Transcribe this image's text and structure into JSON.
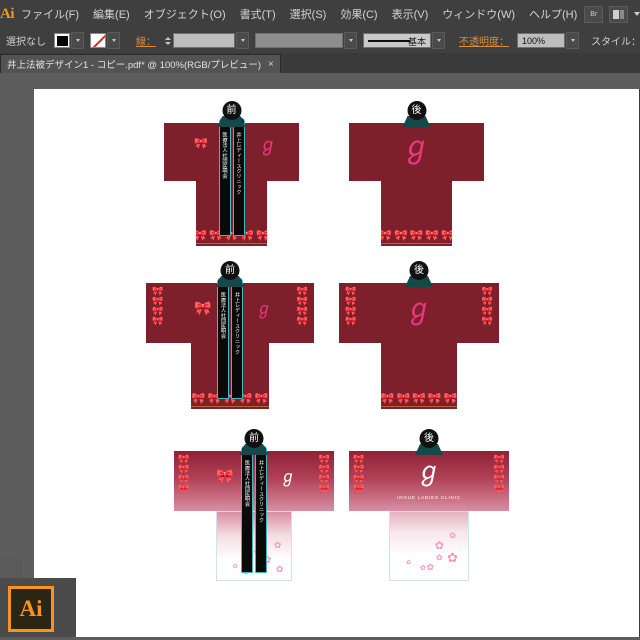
{
  "app": {
    "name": "Ai",
    "logo_label": "Ai",
    "taskbar_icon_label": "Ai"
  },
  "menubar": {
    "items": [
      {
        "label": "ファイル(F)"
      },
      {
        "label": "編集(E)"
      },
      {
        "label": "オブジェクト(O)"
      },
      {
        "label": "書式(T)"
      },
      {
        "label": "選択(S)"
      },
      {
        "label": "効果(C)"
      },
      {
        "label": "表示(V)"
      },
      {
        "label": "ウィンドウ(W)"
      },
      {
        "label": "ヘルプ(H)"
      }
    ],
    "bridge_button_label": "Br",
    "arrange_button_label": "▾"
  },
  "controlbar": {
    "selection_status": "選択なし",
    "fill_label": "fill-swatch",
    "stroke_swatch_label": "stroke-swatch",
    "stroke_label": "線：",
    "stroke_weight_value": "",
    "stroke_profile_value": "",
    "brush_preview_label": "基本",
    "opacity_label": "不透明度：",
    "opacity_value": "100%",
    "style_label": "スタイル：",
    "style_swatch_label": "graphic-style-swatch"
  },
  "document_tab": {
    "title": "井上法被デザイン1 - コピー.pdf* @ 100%(RGB/プレビュー)",
    "close_label": "×"
  },
  "artwork": {
    "title": "井上法被デザイン",
    "front_badge": "前",
    "back_badge": "後",
    "lapel_text_right": "井上レディースクリニック",
    "lapel_text_left": "医療法人社団医明会",
    "back_logo_en": "INOUE LADIES CLINIC",
    "logo_glyph": "ℐ",
    "ribbon_glyph": "🎀",
    "sakura_glyph": "✿",
    "colors": {
      "fabric_dark": "#7e1f2c",
      "fabric_gradient_top": "#8e2236",
      "fabric_gradient_bottom": "#ffffff",
      "ribbon_pink": "#e8387f",
      "ribbon_white": "#ffffff",
      "sakura_pink": "#f29ab6",
      "collar_teal": "#16484a",
      "lapel_black": "#0a0a0a",
      "lapel_outline": "#3fb9c6",
      "gold_trim": "#b8863a"
    },
    "variants": [
      {
        "row": 1,
        "name": "plain-dark-front",
        "side": "前",
        "fabric": "dark",
        "sleeve_pattern": false
      },
      {
        "row": 1,
        "name": "plain-dark-back",
        "side": "後",
        "fabric": "dark",
        "sleeve_pattern": false
      },
      {
        "row": 2,
        "name": "patterned-dark-front",
        "side": "前",
        "fabric": "dark",
        "sleeve_pattern": true
      },
      {
        "row": 2,
        "name": "patterned-dark-back",
        "side": "後",
        "fabric": "dark",
        "sleeve_pattern": true
      },
      {
        "row": 3,
        "name": "gradient-front",
        "side": "前",
        "fabric": "gradient",
        "sleeve_pattern": true
      },
      {
        "row": 3,
        "name": "gradient-back",
        "side": "後",
        "fabric": "gradient",
        "sleeve_pattern": true
      }
    ]
  }
}
